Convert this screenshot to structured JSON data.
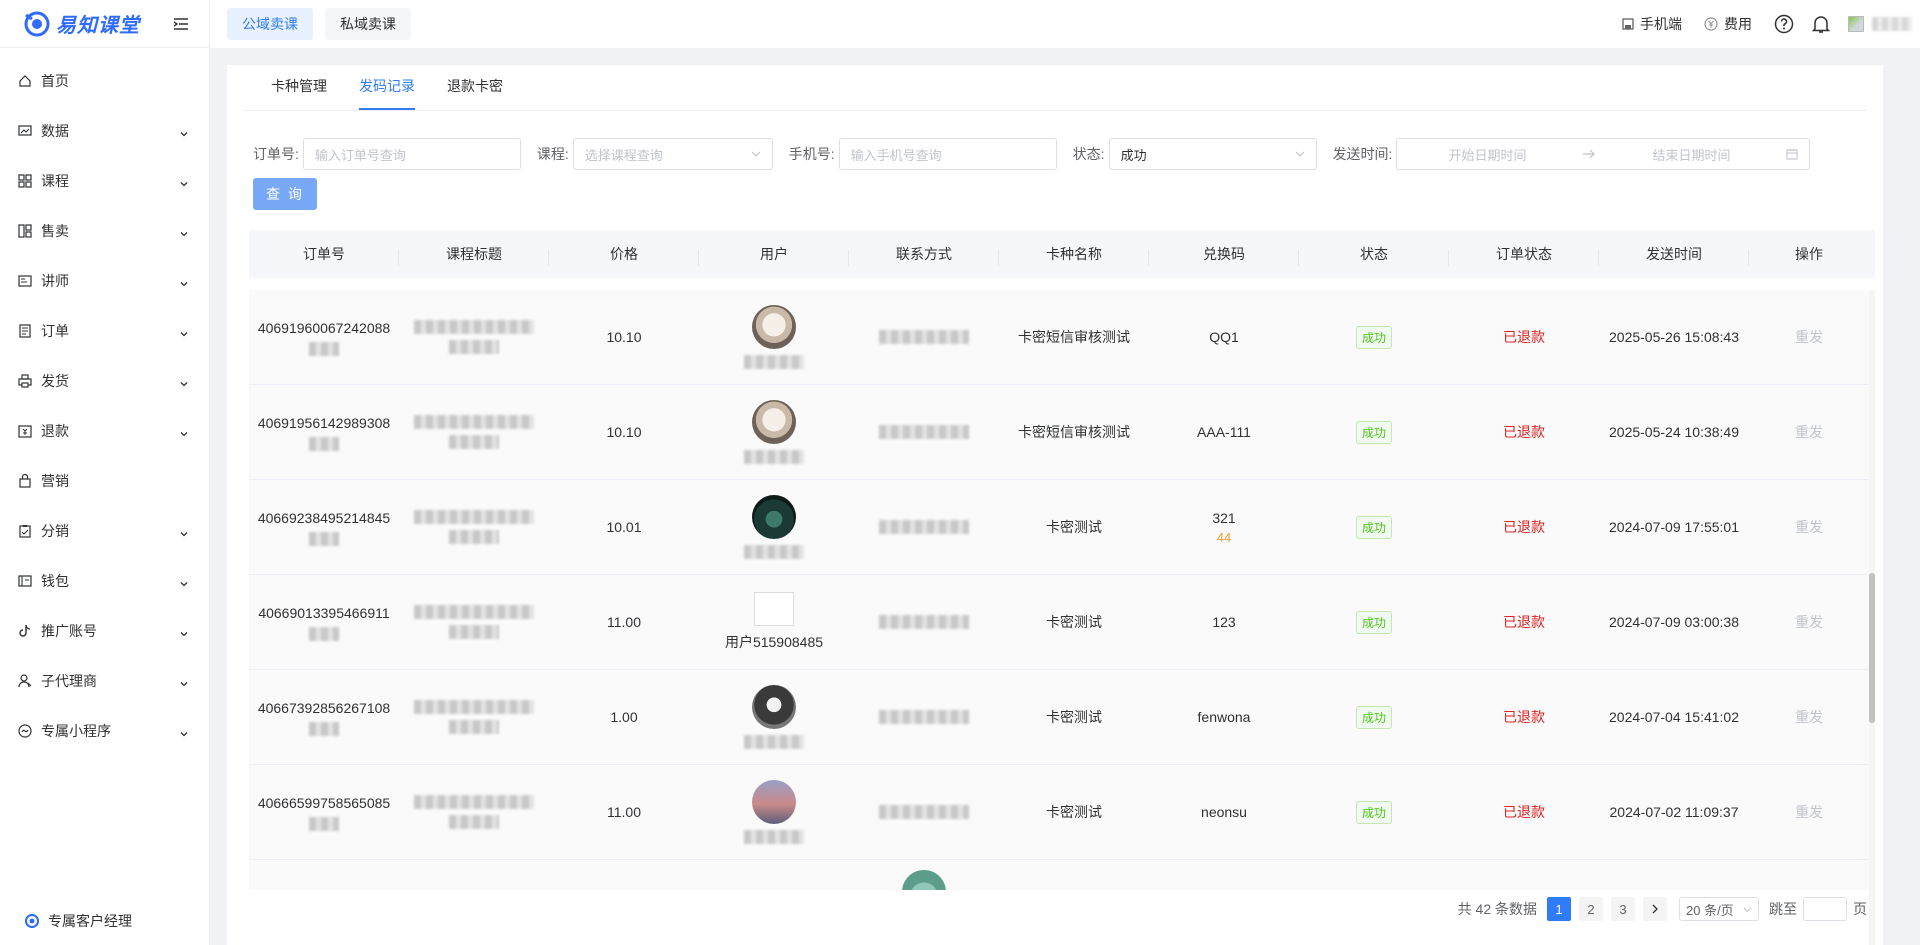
{
  "sidebar": {
    "logo_text": "易知课堂",
    "items": [
      {
        "label": "首页",
        "icon": "home-icon",
        "has_arrow": false
      },
      {
        "label": "数据",
        "icon": "chart-icon",
        "has_arrow": true
      },
      {
        "label": "课程",
        "icon": "grid-icon",
        "has_arrow": true
      },
      {
        "label": "售卖",
        "icon": "shop-icon",
        "has_arrow": true
      },
      {
        "label": "讲师",
        "icon": "teacher-icon",
        "has_arrow": true
      },
      {
        "label": "订单",
        "icon": "order-icon",
        "has_arrow": true
      },
      {
        "label": "发货",
        "icon": "printer-icon",
        "has_arrow": true
      },
      {
        "label": "退款",
        "icon": "refund-icon",
        "has_arrow": true
      },
      {
        "label": "营销",
        "icon": "bag-icon",
        "has_arrow": false
      },
      {
        "label": "分销",
        "icon": "clipboard-icon",
        "has_arrow": true
      },
      {
        "label": "钱包",
        "icon": "wallet-icon",
        "has_arrow": true
      },
      {
        "label": "推广账号",
        "icon": "tiktok-icon",
        "has_arrow": true
      },
      {
        "label": "子代理商",
        "icon": "agent-icon",
        "has_arrow": true
      },
      {
        "label": "专属小程序",
        "icon": "miniapp-icon",
        "has_arrow": true
      }
    ],
    "manager_label": "专属客户经理"
  },
  "header": {
    "tabs": [
      {
        "label": "公域卖课",
        "active": true
      },
      {
        "label": "私域卖课",
        "active": false
      }
    ],
    "mobile_label": "手机端",
    "fee_label": "费用"
  },
  "subtabs": [
    {
      "label": "卡种管理",
      "active": false
    },
    {
      "label": "发码记录",
      "active": true
    },
    {
      "label": "退款卡密",
      "active": false
    }
  ],
  "filters": {
    "order_label": "订单号:",
    "order_placeholder": "输入订单号查询",
    "course_label": "课程:",
    "course_placeholder": "选择课程查询",
    "phone_label": "手机号:",
    "phone_placeholder": "输入手机号查询",
    "status_label": "状态:",
    "status_value": "成功",
    "send_time_label": "发送时间:",
    "start_placeholder": "开始日期时间",
    "end_placeholder": "结束日期时间",
    "query_button": "查 询"
  },
  "table": {
    "columns": [
      "订单号",
      "课程标题",
      "价格",
      "用户",
      "联系方式",
      "卡种名称",
      "兑换码",
      "状态",
      "订单状态",
      "发送时间",
      "操作"
    ],
    "rows": [
      {
        "order_no": "40691960067242088",
        "price": "10.10",
        "user": "",
        "card_type": "卡密短信审核测试",
        "code": "QQ1",
        "code_extra": "",
        "status": "成功",
        "order_status": "已退款",
        "send_time": "2025-05-26 15:08:43",
        "action": "重发",
        "avatar": "cat"
      },
      {
        "order_no": "40691956142989308",
        "price": "10.10",
        "user": "",
        "card_type": "卡密短信审核测试",
        "code": "AAA-111",
        "code_extra": "",
        "status": "成功",
        "order_status": "已退款",
        "send_time": "2025-05-24 10:38:49",
        "action": "重发",
        "avatar": "cat"
      },
      {
        "order_no": "40669238495214845",
        "price": "10.01",
        "user": "",
        "card_type": "卡密测试",
        "code": "321",
        "code_extra": "44",
        "status": "成功",
        "order_status": "已退款",
        "send_time": "2024-07-09 17:55:01",
        "action": "重发",
        "avatar": "dark"
      },
      {
        "order_no": "40669013395466911",
        "price": "11.00",
        "user": "用户515908485",
        "card_type": "卡密测试",
        "code": "123",
        "code_extra": "",
        "status": "成功",
        "order_status": "已退款",
        "send_time": "2024-07-09 03:00:38",
        "action": "重发",
        "avatar": "broken"
      },
      {
        "order_no": "40667392856267108",
        "price": "1.00",
        "user": "",
        "card_type": "卡密测试",
        "code": "fenwona",
        "code_extra": "",
        "status": "成功",
        "order_status": "已退款",
        "send_time": "2024-07-04 15:41:02",
        "action": "重发",
        "avatar": "cartoon"
      },
      {
        "order_no": "40666599758565085",
        "price": "11.00",
        "user": "",
        "card_type": "卡密测试",
        "code": "neonsu",
        "code_extra": "",
        "status": "成功",
        "order_status": "已退款",
        "send_time": "2024-07-02 11:09:37",
        "action": "重发",
        "avatar": "sunset"
      }
    ]
  },
  "pagination": {
    "total_text": "共 42 条数据",
    "pages": [
      "1",
      "2",
      "3"
    ],
    "current": "1",
    "page_size": "20 条/页",
    "jump_label": "跳至",
    "page_suffix": "页"
  },
  "colors": {
    "primary": "#2f7cf6",
    "success": "#52c41a",
    "danger": "#e02020",
    "warning": "#f09d33"
  }
}
